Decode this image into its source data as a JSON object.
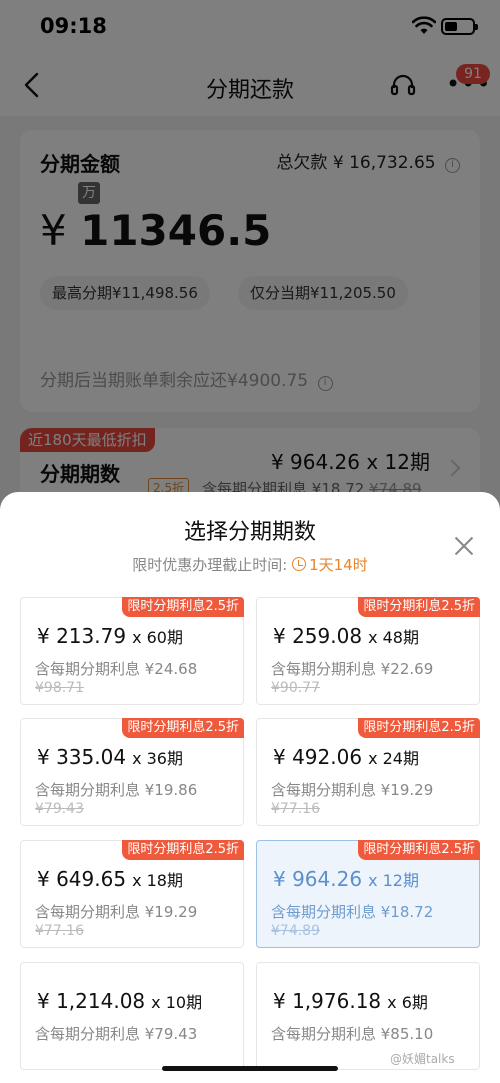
{
  "status_bar": {
    "time": "09:18"
  },
  "nav": {
    "title": "分期还款",
    "message_count": "91"
  },
  "amount_card": {
    "title": "分期金额",
    "total_owed_label": "总欠款",
    "total_owed": "¥ 16,732.65",
    "unit_badge": "万",
    "currency": "¥",
    "amount": "11346.5",
    "max_pill": "最高分期¥11,498.56",
    "min_pill": "仅分当期¥11,205.50",
    "remaining_note": "分期后当期账单剩余应还¥4900.75"
  },
  "term_card": {
    "promo_tag": "近180天最低折扣",
    "title": "分期期数",
    "price": "¥ 964.26 x 12期",
    "discount": "2.5折",
    "interest_label": "含每期分期利息",
    "interest_now": "¥18.72",
    "interest_orig": "¥74.89"
  },
  "sheet": {
    "title": "选择分期期数",
    "deadline_label": "限时优惠办理截止时间:",
    "countdown": "1天14时",
    "options": [
      {
        "tag": "限时分期利息2.5折",
        "price": "¥ 213.79",
        "term": "x 60期",
        "interest": "含每期分期利息 ¥24.68",
        "orig": "¥98.71"
      },
      {
        "tag": "限时分期利息2.5折",
        "price": "¥ 259.08",
        "term": "x 48期",
        "interest": "含每期分期利息 ¥22.69",
        "orig": "¥90.77"
      },
      {
        "tag": "限时分期利息2.5折",
        "price": "¥ 335.04",
        "term": "x 36期",
        "interest": "含每期分期利息 ¥19.86",
        "orig": "¥79.43"
      },
      {
        "tag": "限时分期利息2.5折",
        "price": "¥ 492.06",
        "term": "x 24期",
        "interest": "含每期分期利息 ¥19.29",
        "orig": "¥77.16"
      },
      {
        "tag": "限时分期利息2.5折",
        "price": "¥ 649.65",
        "term": "x 18期",
        "interest": "含每期分期利息 ¥19.29",
        "orig": "¥77.16"
      },
      {
        "tag": "限时分期利息2.5折",
        "price": "¥ 964.26",
        "term": "x 12期",
        "interest": "含每期分期利息 ¥18.72",
        "orig": "¥74.89",
        "selected": true
      },
      {
        "price": "¥ 1,214.08",
        "term": "x 10期",
        "interest": "含每期分期利息 ¥79.43"
      },
      {
        "price": "¥ 1,976.18",
        "term": "x 6期",
        "interest": "含每期分期利息 ¥85.10"
      }
    ]
  },
  "watermark": "@妖媚talks",
  "colors": {
    "accent_red": "#ef5a3c",
    "countdown_orange": "#e8862c",
    "selected_blue": "#5b8fcf"
  }
}
